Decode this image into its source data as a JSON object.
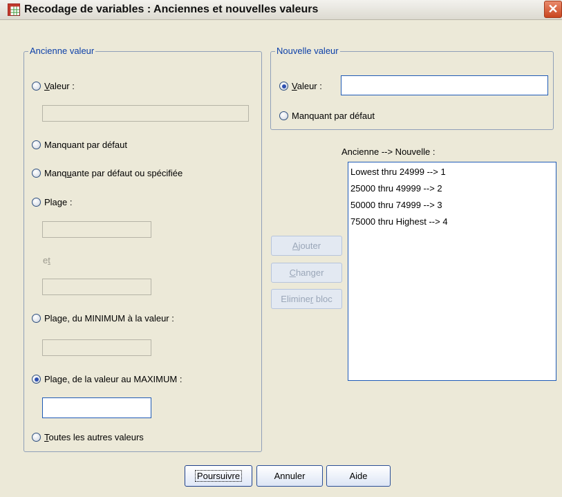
{
  "window": {
    "title": "Recodage de variables : Anciennes et nouvelles valeurs",
    "close_label": "✕"
  },
  "old_value": {
    "group_label": "Ancienne valeur",
    "radio_value": {
      "pre": "",
      "u": "V",
      "post": "aleur :"
    },
    "value_input": "",
    "radio_sysmiss": "Manquant par défaut",
    "radio_sysuser": {
      "pre": "Manq",
      "u": "u",
      "post": "ante par défaut ou spécifiée"
    },
    "radio_range": "Plage :",
    "range_low": "",
    "and_label": {
      "pre": "e",
      "u": "t",
      "post": ""
    },
    "range_high": "",
    "radio_range_lowest": {
      "pre": "Pla",
      "u": "g",
      "post": "e, du MINIMUM à la valeur :"
    },
    "range_lowest_input": "",
    "radio_range_highest": {
      "pre": "Plage",
      "u": ",",
      "post": " de la valeur au MAXIMUM :"
    },
    "range_highest_input": "",
    "radio_all_other": {
      "pre": "",
      "u": "T",
      "post": "outes les autres valeurs"
    },
    "selected": "range_highest"
  },
  "new_value": {
    "group_label": "Nouvelle valeur",
    "radio_value": {
      "pre": "",
      "u": "V",
      "post": "aleur :"
    },
    "value_input": "",
    "radio_sysmiss": "Manquant par défaut",
    "selected": "value"
  },
  "actions": {
    "add": {
      "pre": "",
      "u": "A",
      "post": "jouter"
    },
    "change": {
      "pre": "",
      "u": "C",
      "post": "hanger"
    },
    "remove": {
      "pre": "Elimine",
      "u": "r",
      "post": " bloc"
    }
  },
  "list": {
    "label": "Ancienne --> Nouvelle :",
    "items": [
      "Lowest thru 24999 --> 1",
      "25000 thru 49999 --> 2",
      "50000 thru 74999 --> 3",
      "75000 thru Highest --> 4"
    ]
  },
  "footer": {
    "continue": "Poursuivre",
    "cancel": "Annuler",
    "help": "Aide"
  },
  "colors": {
    "dialog_bg": "#ece9d8",
    "group_label": "#0b3fa8",
    "accent": "#1e5ab6",
    "close": "#c9451f"
  },
  "icons": {
    "app": "data-editor-grid-icon",
    "close": "close-icon"
  }
}
